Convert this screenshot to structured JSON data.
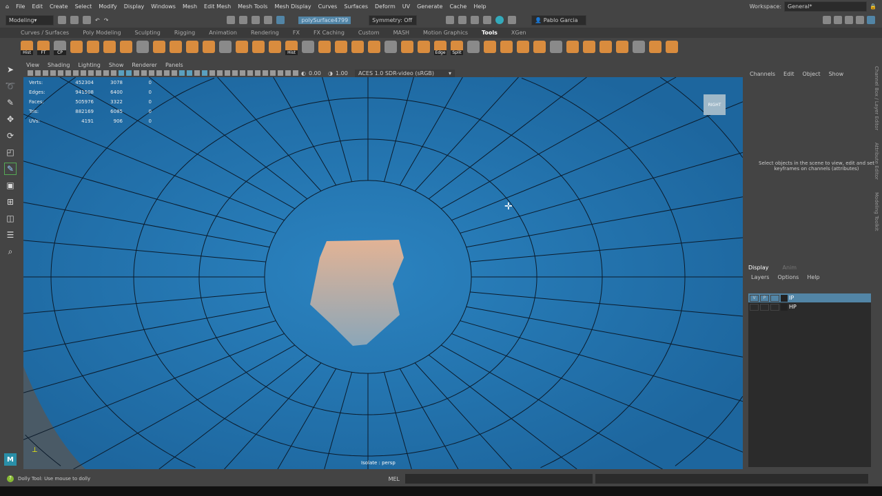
{
  "menubar": {
    "items": [
      "File",
      "Edit",
      "Create",
      "Select",
      "Modify",
      "Display",
      "Windows",
      "Mesh",
      "Edit Mesh",
      "Mesh Tools",
      "Mesh Display",
      "Curves",
      "Surfaces",
      "Deform",
      "UV",
      "Generate",
      "Cache",
      "Help"
    ],
    "workspace_label": "Workspace:",
    "workspace_value": "General*"
  },
  "statusline": {
    "mode": "Modeling",
    "object_field": "polySurface4799",
    "symmetry": "Symmetry: Off",
    "user": "Pablo Garcia"
  },
  "shelf": {
    "tabs": [
      "Curves / Surfaces",
      "Poly Modeling",
      "Sculpting",
      "Rigging",
      "Animation",
      "Rendering",
      "FX",
      "FX Caching",
      "Custom",
      "MASH",
      "Motion Graphics",
      "Tools",
      "XGen"
    ],
    "active_tab": "Tools",
    "icon_labels": [
      "Hist",
      "FT",
      "CP",
      "",
      "",
      "",
      "",
      "",
      "",
      "",
      "",
      "",
      "",
      "",
      "",
      "",
      "Hist",
      "",
      "",
      "",
      "",
      "",
      "",
      "",
      "",
      "Edge",
      "Split",
      "",
      "",
      "",
      "",
      "",
      "",
      "",
      "",
      "",
      "",
      "",
      "",
      ""
    ]
  },
  "viewport": {
    "menu": [
      "View",
      "Shading",
      "Lighting",
      "Show",
      "Renderer",
      "Panels"
    ],
    "exposure": "0.00",
    "gamma": "1.00",
    "color_space": "ACES 1.0 SDR-video (sRGB)",
    "view_cube": "RIGHT",
    "camera_label": "Isolate : persp",
    "stats": [
      {
        "label": "Verts:",
        "a": "452304",
        "b": "3078",
        "c": "0"
      },
      {
        "label": "Edges:",
        "a": "941508",
        "b": "6400",
        "c": "0"
      },
      {
        "label": "Faces:",
        "a": "505976",
        "b": "3322",
        "c": "0"
      },
      {
        "label": "Tris:",
        "a": "882169",
        "b": "6085",
        "c": "0"
      },
      {
        "label": "UVs:",
        "a": "4191",
        "b": "906",
        "c": "0"
      }
    ]
  },
  "channel_box": {
    "menu": [
      "Channels",
      "Edit",
      "Object",
      "Show"
    ],
    "message": "Select objects in the scene to view, edit and set keyframes on channels (attributes)",
    "side_tabs": [
      "Channel Box / Layer Editor",
      "Attribute Editor",
      "Modeling Toolkit"
    ]
  },
  "layers": {
    "tabs": [
      "Display",
      "Anim"
    ],
    "menu": [
      "Layers",
      "Options",
      "Help"
    ],
    "rows": [
      {
        "v": "V",
        "p": "P",
        "name": "IP",
        "selected": true
      },
      {
        "v": "",
        "p": "",
        "name": "HP",
        "selected": false
      }
    ]
  },
  "status": {
    "help": "Dolly Tool: Use mouse to dolly",
    "lang": "MEL"
  },
  "colors": {
    "accent": "#5285a6",
    "viewport": "#1f6ea8",
    "skin": "#e0b294"
  }
}
